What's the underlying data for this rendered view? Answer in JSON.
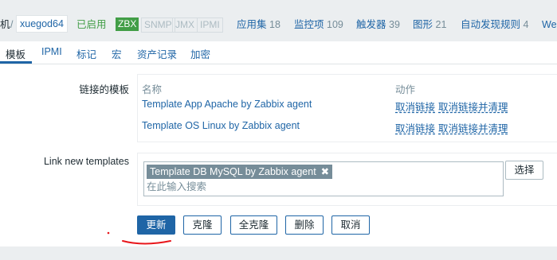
{
  "header": {
    "host_fragment": "机",
    "separator": "/",
    "host_name": "xuegod64",
    "status": "已启用",
    "badges": [
      "ZBX",
      "SNMP",
      "JMX",
      "IPMI"
    ],
    "links": [
      {
        "label": "应用集",
        "count": "18"
      },
      {
        "label": "监控项",
        "count": "109"
      },
      {
        "label": "触发器",
        "count": "39"
      },
      {
        "label": "图形",
        "count": "21"
      },
      {
        "label": "自动发现规则",
        "count": "4"
      },
      {
        "label": "Web",
        "count": ""
      }
    ]
  },
  "tabs": [
    "模板",
    "IPMI",
    "标记",
    "宏",
    "资产记录",
    "加密"
  ],
  "linked_templates": {
    "label": "链接的模板",
    "col_name": "名称",
    "col_action": "动作",
    "rows": [
      {
        "name": "Template App Apache by Zabbix agent",
        "unlink": "取消链接",
        "unlink_clear": "取消链接并清理"
      },
      {
        "name": "Template OS Linux by Zabbix agent",
        "unlink": "取消链接",
        "unlink_clear": "取消链接并清理"
      }
    ]
  },
  "new_templates": {
    "label": "Link new templates",
    "chip": "Template DB MySQL by Zabbix agent",
    "chip_remove": "✖",
    "placeholder": "在此输入搜索",
    "select_button": "选择"
  },
  "buttons": {
    "update": "更新",
    "clone": "克隆",
    "full_clone": "全克隆",
    "delete": "删除",
    "cancel": "取消"
  },
  "colors": {
    "accent": "#1f65a6",
    "enabled": "#429e47",
    "annotation": "#e8161b"
  }
}
